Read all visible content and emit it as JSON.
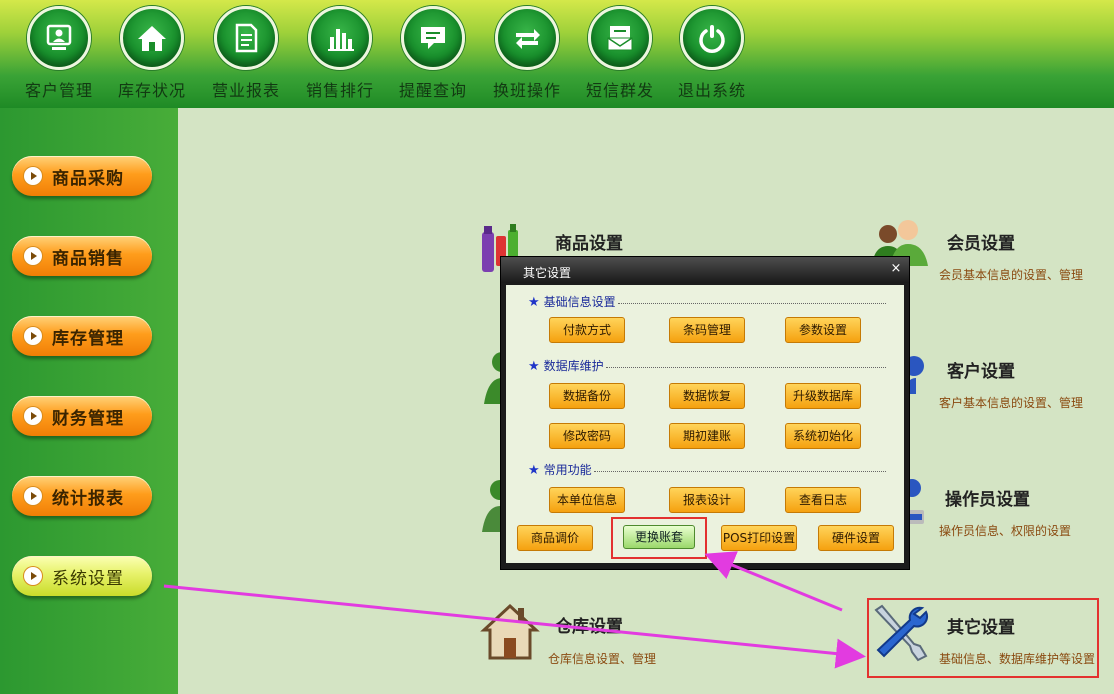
{
  "top_nav": [
    {
      "label": "客户管理",
      "icon": "customer-icon"
    },
    {
      "label": "库存状况",
      "icon": "home-icon"
    },
    {
      "label": "营业报表",
      "icon": "report-icon"
    },
    {
      "label": "销售排行",
      "icon": "bar-chart-icon"
    },
    {
      "label": "提醒查询",
      "icon": "message-icon"
    },
    {
      "label": "换班操作",
      "icon": "swap-icon"
    },
    {
      "label": "短信群发",
      "icon": "sms-icon"
    },
    {
      "label": "退出系统",
      "icon": "power-icon"
    }
  ],
  "sidebar": [
    {
      "label": "商品采购",
      "active": false
    },
    {
      "label": "商品销售",
      "active": false
    },
    {
      "label": "库存管理",
      "active": false
    },
    {
      "label": "财务管理",
      "active": false
    },
    {
      "label": "统计报表",
      "active": false
    },
    {
      "label": "系统设置",
      "active": true
    }
  ],
  "cards": {
    "goods": {
      "title": "商品设置"
    },
    "member": {
      "title": "会员设置",
      "desc": "会员基本信息的设置、管理"
    },
    "customer": {
      "title": "客户设置",
      "desc": "客户基本信息的设置、管理"
    },
    "operator": {
      "title": "操作员设置",
      "desc": "操作员信息、权限的设置"
    },
    "warehouse": {
      "title": "仓库设置",
      "desc": "仓库信息设置、管理"
    },
    "other": {
      "title": "其它设置",
      "desc": "基础信息、数据库维护等设置"
    }
  },
  "dialog": {
    "title": "其它设置",
    "close": "×",
    "sections": {
      "basic": {
        "label": "基础信息设置",
        "buttons": [
          "付款方式",
          "条码管理",
          "参数设置"
        ]
      },
      "db": {
        "label": "数据库维护",
        "buttons": [
          "数据备份",
          "数据恢复",
          "升级数据库",
          "修改密码",
          "期初建账",
          "系统初始化"
        ]
      },
      "common": {
        "label": "常用功能",
        "buttons": [
          "本单位信息",
          "报表设计",
          "查看日志"
        ]
      }
    },
    "bottom_buttons": [
      "商品调价",
      "更换账套",
      "POS打印设置",
      "硬件设置"
    ]
  },
  "colors": {
    "highlight": "#e3312f",
    "arrow": "#e23be0",
    "accent": "#f5a10f"
  }
}
